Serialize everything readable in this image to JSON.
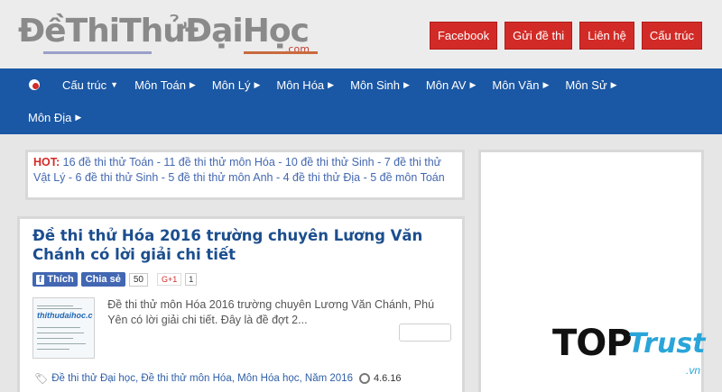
{
  "header": {
    "logo_text": "ĐềThiThửĐạiHọc",
    "logo_suffix": ".com",
    "buttons": [
      "Facebook",
      "Gửi đề thi",
      "Liên hệ",
      "Cấu trúc"
    ]
  },
  "nav": {
    "items_row1": [
      {
        "label": "Cấu trúc",
        "caret": "▼"
      },
      {
        "label": "Môn Toán",
        "caret": "▶"
      },
      {
        "label": "Môn Lý",
        "caret": "▶"
      },
      {
        "label": "Môn Hóa",
        "caret": "▶"
      },
      {
        "label": "Môn Sinh",
        "caret": "▶"
      },
      {
        "label": "Môn AV",
        "caret": "▶"
      },
      {
        "label": "Môn Văn",
        "caret": "▶"
      },
      {
        "label": "Môn Sử",
        "caret": "▶"
      }
    ],
    "items_row2": [
      {
        "label": "Môn Địa",
        "caret": "▶"
      }
    ]
  },
  "hot": {
    "label": "HOT:",
    "text": " 16 đề thi thử Toán - 11 đề thi thử môn Hóa - 10 đề thi thử Sinh - 7 đề thi thử Vật Lý - 6 đề thi thử Sinh - 5 đề thi thử môn Anh - 4 đề thi thử Địa - 5 đề môn Toán"
  },
  "post": {
    "title": "Đề thi thử Hóa 2016 trường chuyên Lương Văn Chánh có lời giải chi tiết",
    "like_label": "Thích",
    "share_label": "Chia sẻ",
    "share_count": "50",
    "gplus_label": "G+1",
    "gplus_count": "1",
    "thumb_text": "thithudaihoc.c",
    "excerpt": "Đề thi thử môn Hóa 2016 trường chuyên Lương Văn Chánh, Phú Yên có lời giải chi tiết. Đây là đề đợt 2...",
    "tags": "Đề thi thử Đại học, Đề thi thử môn Hóa, Môn Hóa học, Năm 2016",
    "date": "4.6.16"
  },
  "watermark": {
    "top": "TOP",
    "trust": "Trust",
    "vn": ".vn"
  },
  "colors": {
    "nav_bg": "#1a57a4",
    "button_red": "#d22b27",
    "title_blue": "#1c4e8e"
  }
}
